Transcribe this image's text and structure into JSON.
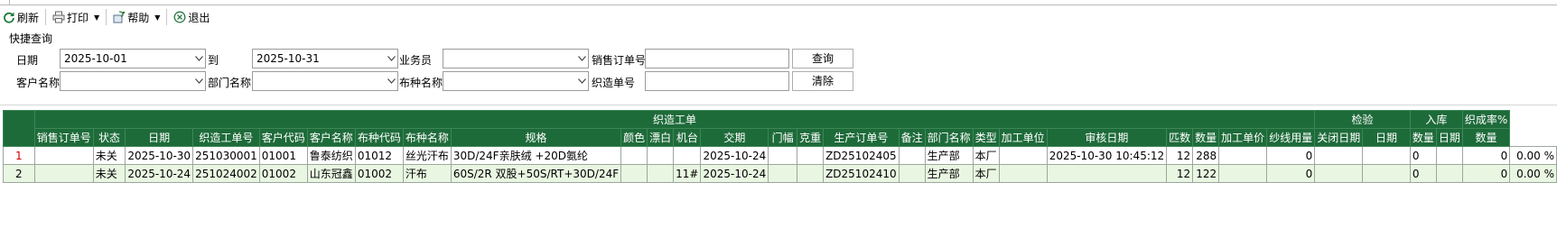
{
  "toolbar": {
    "refresh": "刷新",
    "print": "打印",
    "help": "帮助",
    "exit": "退出"
  },
  "query": {
    "title": "快捷查询",
    "date_label": "日期",
    "date_from": "2025-10-01",
    "to_label": "到",
    "date_to": "2025-10-31",
    "salesman_label": "业务员",
    "salesman_value": "",
    "sales_order_label": "销售订单号",
    "sales_order_value": "",
    "query_button": "查询",
    "customer_label": "客户名称",
    "customer_value": "",
    "dept_label": "部门名称",
    "dept_value": "",
    "fabric_label": "布种名称",
    "fabric_value": "",
    "weave_label": "织造单号",
    "weave_value": "",
    "clear_button": "清除"
  },
  "grid": {
    "group_headers": {
      "weave": "织造工单",
      "inspect": "检验",
      "stock": "入库",
      "rate": "织成率%"
    },
    "columns": [
      "销售订单号",
      "状态",
      "日期",
      "织造工单号",
      "客户代码",
      "客户名称",
      "布种代码",
      "布种名称",
      "规格",
      "颜色",
      "漂白",
      "机台",
      "交期",
      "门幅",
      "克重",
      "生产订单号",
      "备注",
      "部门名称",
      "类型",
      "加工单位",
      "审核日期",
      "匹数",
      "数量",
      "加工单价",
      "纱线用量",
      "关闭日期",
      "日期",
      "数量",
      "日期",
      "数量",
      "织成率"
    ],
    "rows": [
      {
        "num": "1",
        "cells": [
          "",
          "未关",
          "2025-10-30",
          "251030001",
          "01001",
          "鲁泰纺织",
          "01012",
          "丝光汗布",
          "30D/24F亲肤绒 +20D氨纶",
          "",
          "",
          "",
          "2025-10-24",
          "",
          "",
          "ZD25102405",
          "",
          "生产部",
          "本厂",
          "",
          "2025-10-30 10:45:12",
          "12",
          "288",
          "",
          "0",
          "",
          "",
          "0",
          "",
          "0",
          "0.00 %"
        ]
      },
      {
        "num": "2",
        "cells": [
          "",
          "未关",
          "2025-10-24",
          "251024002",
          "01002",
          "山东冠鑫",
          "01002",
          "汗布",
          "60S/2R 双股+50S/RT+30D/24F",
          "",
          "",
          "11#",
          "2025-10-24",
          "",
          "",
          "ZD25102410",
          "",
          "生产部",
          "本厂",
          "",
          "",
          "12",
          "122",
          "",
          "0",
          "",
          "",
          "0",
          "",
          "0",
          "0.00 %"
        ]
      }
    ]
  }
}
